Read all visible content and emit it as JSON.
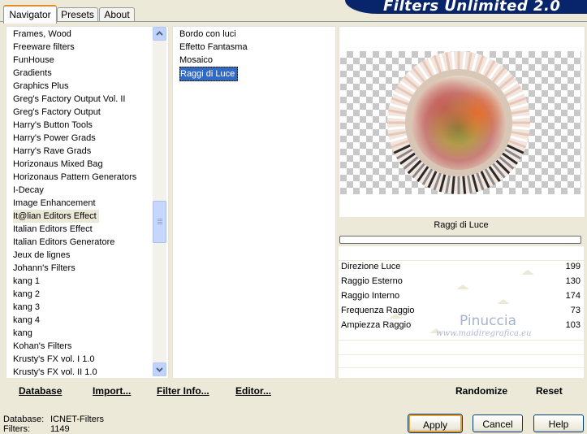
{
  "tabs": [
    {
      "label": "Navigator",
      "active": true
    },
    {
      "label": "Presets",
      "active": false
    },
    {
      "label": "About",
      "active": false
    }
  ],
  "banner": {
    "title": "Filters Unlimited 2.0"
  },
  "categories": {
    "items": [
      "Frames, Wood",
      "Freeware filters",
      "FunHouse",
      "Gradients",
      "Graphics Plus",
      "Greg's Factory Output Vol. II",
      "Greg's Factory Output",
      "Harry's Button Tools",
      "Harry's Power Grads",
      "Harry's Rave Grads",
      "Horizonaus Mixed Bag",
      "Horizonaus Pattern Generators",
      "I-Decay",
      "Image Enhancement",
      "It@lian Editors Effect",
      "Italian Editors Effect",
      "Italian Editors Generatore",
      "Jeux de lignes",
      "Johann's Filters",
      "kang 1",
      "kang 2",
      "kang 3",
      "kang 4",
      "kang",
      "Kohan's Filters",
      "Krusty's FX vol. I 1.0",
      "Krusty's FX vol. II 1.0"
    ],
    "highlighted_index": 14
  },
  "filters": {
    "items": [
      "Bordo con luci",
      "Effetto Fantasma",
      "Mosaico",
      "Raggi di Luce"
    ],
    "selected_index": 3
  },
  "toolbar": {
    "database": "Database",
    "import": "Import...",
    "filter_info": "Filter Info...",
    "editor": "Editor...",
    "randomize": "Randomize",
    "reset": "Reset"
  },
  "preview": {
    "filter_name": "Raggi di Luce"
  },
  "params": [
    {
      "label": "Direzione Luce",
      "value": "199"
    },
    {
      "label": "Raggio Esterno",
      "value": "130"
    },
    {
      "label": "Raggio Interno",
      "value": "174"
    },
    {
      "label": "Frequenza Raggio",
      "value": "73"
    },
    {
      "label": "Ampiezza Raggio",
      "value": "103"
    }
  ],
  "watermark": {
    "name": "Pinuccia",
    "url": "www.maidiregrafica.eu"
  },
  "status": {
    "database_label": "Database:",
    "database_value": "ICNET-Filters",
    "filters_label": "Filters:",
    "filters_value": "1149"
  },
  "buttons": {
    "apply": "Apply",
    "cancel": "Cancel",
    "help": "Help"
  }
}
